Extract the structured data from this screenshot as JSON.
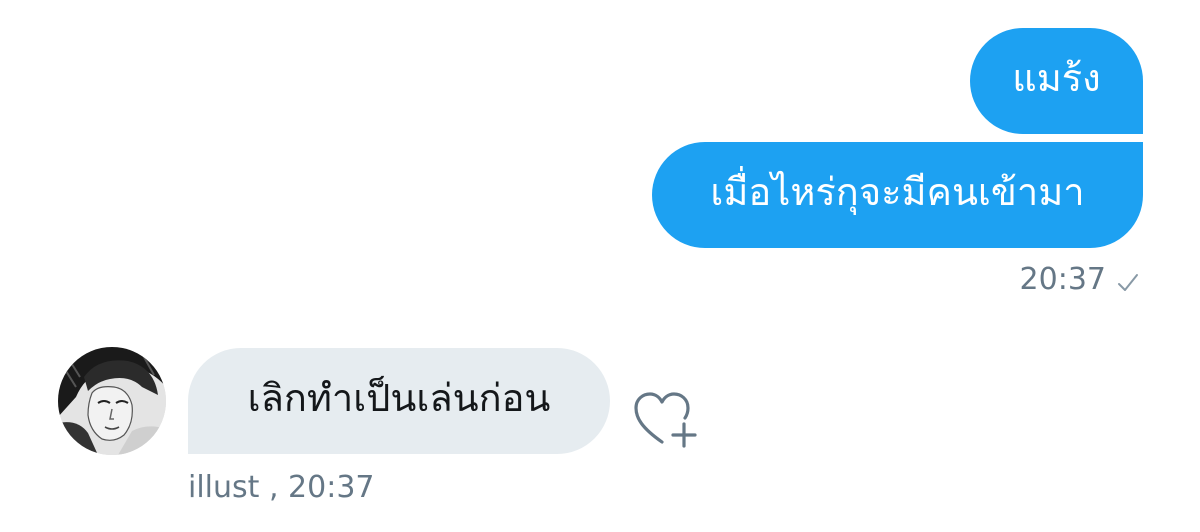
{
  "conversation": {
    "sent_messages": [
      {
        "text": "แมร้ง"
      },
      {
        "text": "เมื่อไหร่กุจะมีคนเข้ามา"
      }
    ],
    "sent_meta": {
      "time": "20:37"
    },
    "received_messages": [
      {
        "text": "เลิกทำเป็นเล่นก่อน"
      }
    ],
    "received_meta": {
      "sender": "illust",
      "separator": " ,",
      "time": "20:37"
    }
  },
  "icons": {
    "read_receipt": "check-icon",
    "react": "heart-plus-icon",
    "avatar": "profile-photo-bw"
  },
  "colors": {
    "sent_bubble": "#1da1f2",
    "received_bubble": "#e6ecf0",
    "meta_text": "#657786",
    "received_text": "#14171a"
  }
}
